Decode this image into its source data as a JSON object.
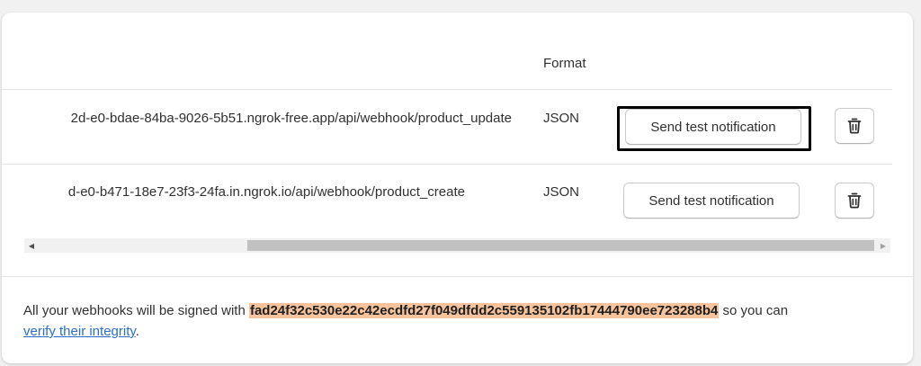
{
  "table": {
    "format_header": "Format",
    "rows": [
      {
        "url": "2d-e0-bdae-84ba-9026-5b51.ngrok-free.app/api/webhook/product_update",
        "format": "JSON",
        "send_label": "Send test notification",
        "delete_icon": "trash-icon"
      },
      {
        "url": "d-e0-b471-18e7-23f3-24fa.in.ngrok.io/api/webhook/product_create",
        "format": "JSON",
        "send_label": "Send test notification",
        "delete_icon": "trash-icon"
      }
    ]
  },
  "footer": {
    "text_before": "All your webhooks will be signed with ",
    "secret": "fad24f32c530e22c42ecdfd27f049dfdd2c559135102fb17444790ee723288b4",
    "text_after": " so you can",
    "link_text": "verify their integrity",
    "end": "."
  },
  "colors": {
    "secret_highlight": "#f6c39d",
    "link": "#2c6ecb"
  }
}
